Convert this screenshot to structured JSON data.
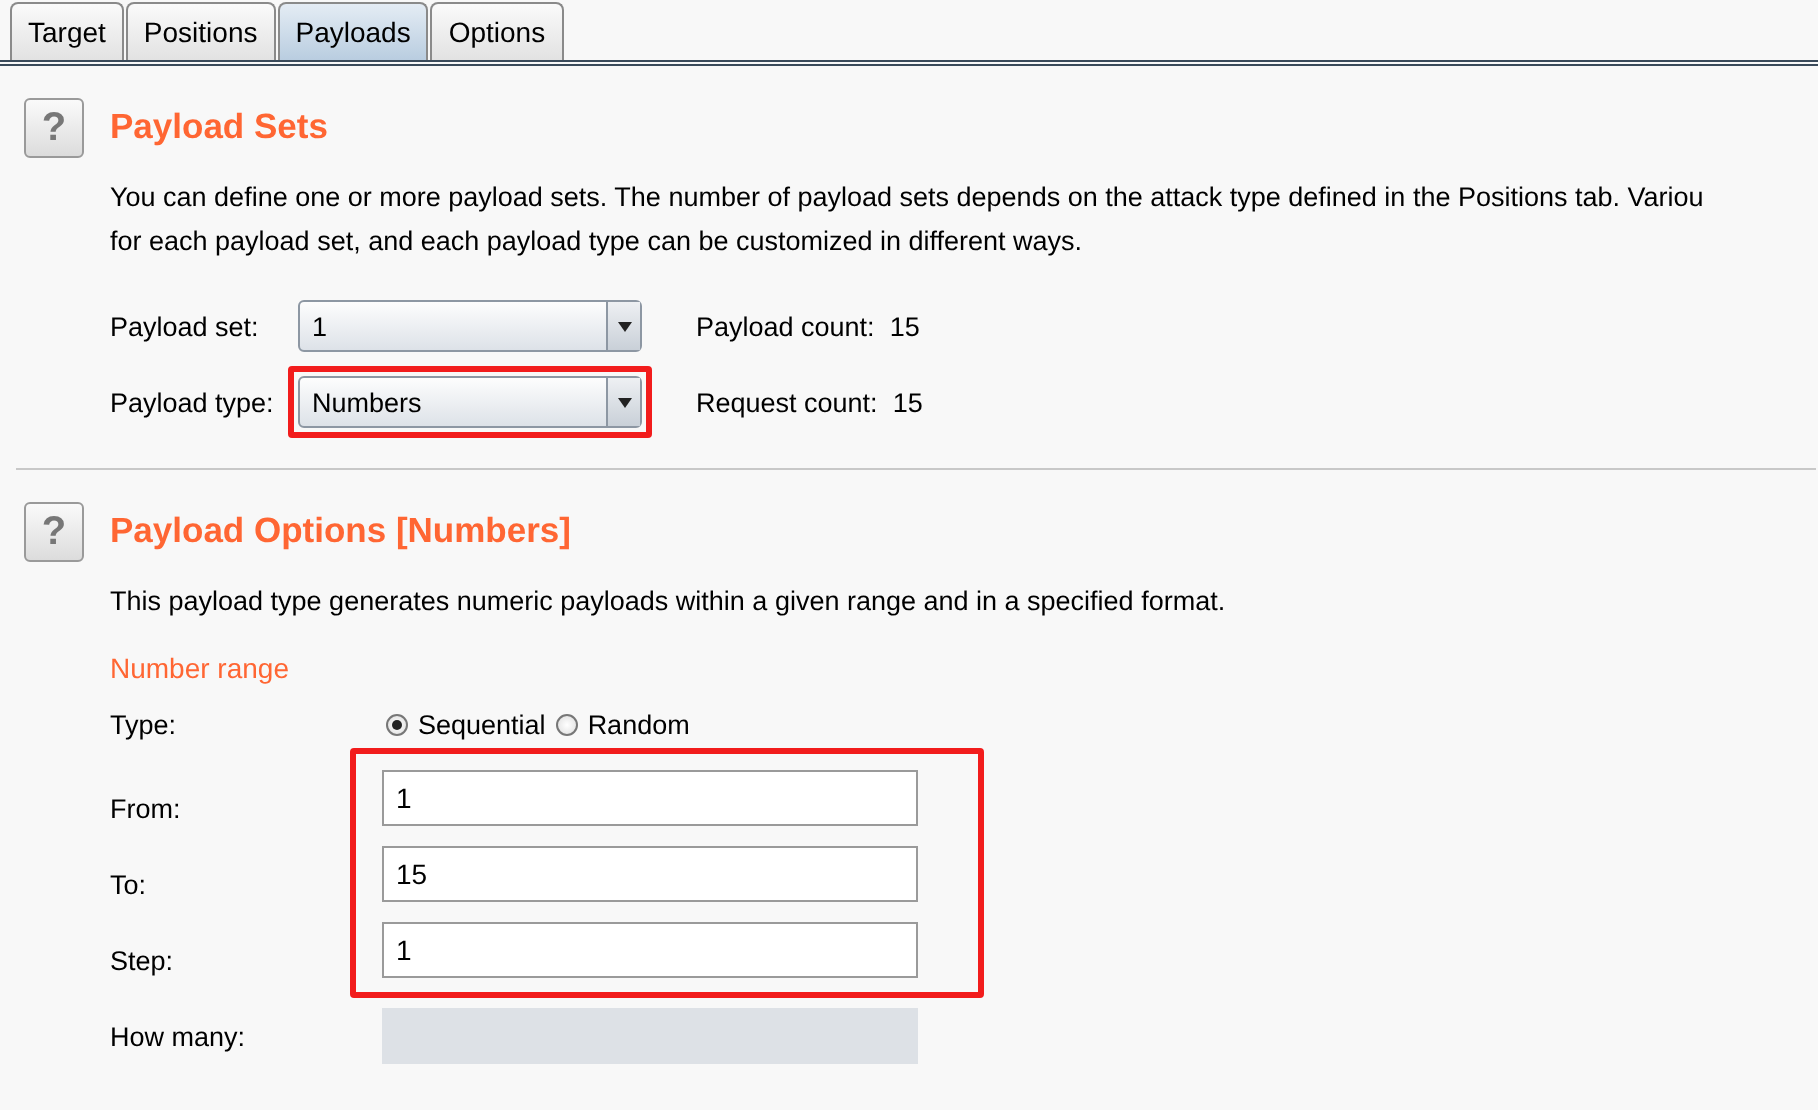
{
  "tabs": [
    {
      "label": "Target",
      "selected": false
    },
    {
      "label": "Positions",
      "selected": false
    },
    {
      "label": "Payloads",
      "selected": true
    },
    {
      "label": "Options",
      "selected": false
    }
  ],
  "payload_sets": {
    "help": "?",
    "title": "Payload Sets",
    "description": [
      "You can define one or more payload sets. The number of payload sets depends on the attack type defined in the Positions tab. Variou",
      "for each payload set, and each payload type can be customized in different ways."
    ],
    "payload_set": {
      "label": "Payload set:",
      "value": "1",
      "highlighted": false
    },
    "payload_count": {
      "label": "Payload count:",
      "value": "15"
    },
    "payload_type": {
      "label": "Payload type:",
      "value": "Numbers",
      "highlighted": true
    },
    "request_count": {
      "label": "Request count:",
      "value": "15"
    }
  },
  "payload_options": {
    "help": "?",
    "title": "Payload Options [Numbers]",
    "description": "This payload type generates numeric payloads within a given range and in a specified format.",
    "section_label": "Number range",
    "type": {
      "label": "Type:",
      "options": [
        {
          "label": "Sequential",
          "selected": true
        },
        {
          "label": "Random",
          "selected": false
        }
      ]
    },
    "fields": [
      {
        "label": "From:",
        "value": "1"
      },
      {
        "label": "To:",
        "value": "15"
      },
      {
        "label": "Step:",
        "value": "1"
      }
    ],
    "fields_highlighted": true,
    "how_many": {
      "label": "How many:",
      "disabled": true
    }
  }
}
